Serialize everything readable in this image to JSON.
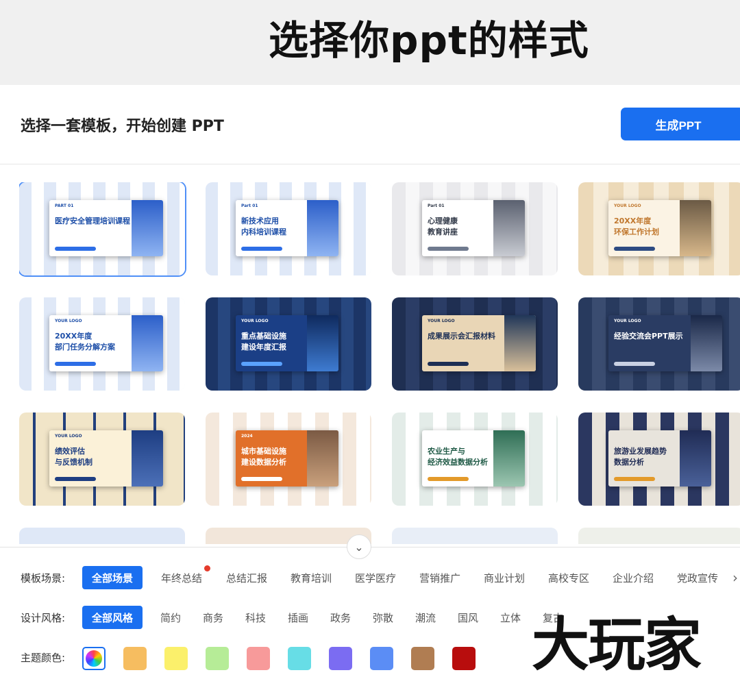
{
  "banner": {
    "headline": "选择你ppt的样式"
  },
  "header": {
    "subtitle": "选择一套模板，开始创建 PPT",
    "generate_label": "生成PPT",
    "accent": "#1a6ff0"
  },
  "templates": [
    {
      "logo": "PART 01",
      "line1": "医疗安全管理培训课程",
      "line2": "",
      "theme": "blue-white",
      "selected": true
    },
    {
      "logo": "Part 01",
      "line1": "新技术应用",
      "line2": "内科培训课程",
      "theme": "blue-white"
    },
    {
      "logo": "Part 01",
      "line1": "心理健康",
      "line2": "教育讲座",
      "theme": "gray-white"
    },
    {
      "logo": "YOUR LOGO",
      "line1": "20XX年度",
      "line2": "环保工作计划",
      "theme": "beige"
    },
    {
      "logo": "YOUR LOGO",
      "line1": "20XX年度",
      "line2": "部门任务分解方案",
      "theme": "blue-white"
    },
    {
      "logo": "YOUR LOGO",
      "line1": "重点基础设施",
      "line2": "建设年度汇报",
      "theme": "navy"
    },
    {
      "logo": "YOUR LOGO",
      "line1": "成果展示会汇报材料",
      "line2": "",
      "theme": "navy-beige"
    },
    {
      "logo": "YOUR LOGO",
      "line1": "经验交流会PPT展示",
      "line2": "",
      "theme": "navy-gray"
    },
    {
      "logo": "YOUR LOGO",
      "line1": "绩效评估",
      "line2": "与反馈机制",
      "theme": "cream-navy"
    },
    {
      "logo": "2024",
      "line1": "城市基础设施",
      "line2": "建设数据分析",
      "theme": "orange"
    },
    {
      "logo": "",
      "line1": "农业生产与",
      "line2": "经济效益数据分析",
      "theme": "green"
    },
    {
      "logo": "",
      "line1": "旅游业发展趋势",
      "line2": "数据分析",
      "theme": "navy-orange"
    }
  ],
  "filters": {
    "scene": {
      "label": "模板场景:",
      "options": [
        "全部场景",
        "年终总结",
        "总结汇报",
        "教育培训",
        "医学医疗",
        "营销推广",
        "商业计划",
        "高校专区",
        "企业介绍",
        "党政宣传"
      ],
      "active": 0
    },
    "style": {
      "label": "设计风格:",
      "options": [
        "全部风格",
        "简约",
        "商务",
        "科技",
        "插画",
        "政务",
        "弥散",
        "潮流",
        "国风",
        "立体",
        "复古"
      ],
      "active": 0
    },
    "color": {
      "label": "主题颜色:",
      "swatches": [
        "#f6bd60",
        "#fbf06b",
        "#b6ec97",
        "#f79a9a",
        "#67dde6",
        "#7b6cf2",
        "#5b8df5",
        "#b07d52",
        "#b80d0d"
      ]
    }
  },
  "watermark": "大玩家",
  "icons": {
    "collapse": "chevron-down-icon",
    "next": "chevron-right-icon",
    "all_colors": "color-wheel-icon",
    "hot": "hot-dot-icon"
  }
}
